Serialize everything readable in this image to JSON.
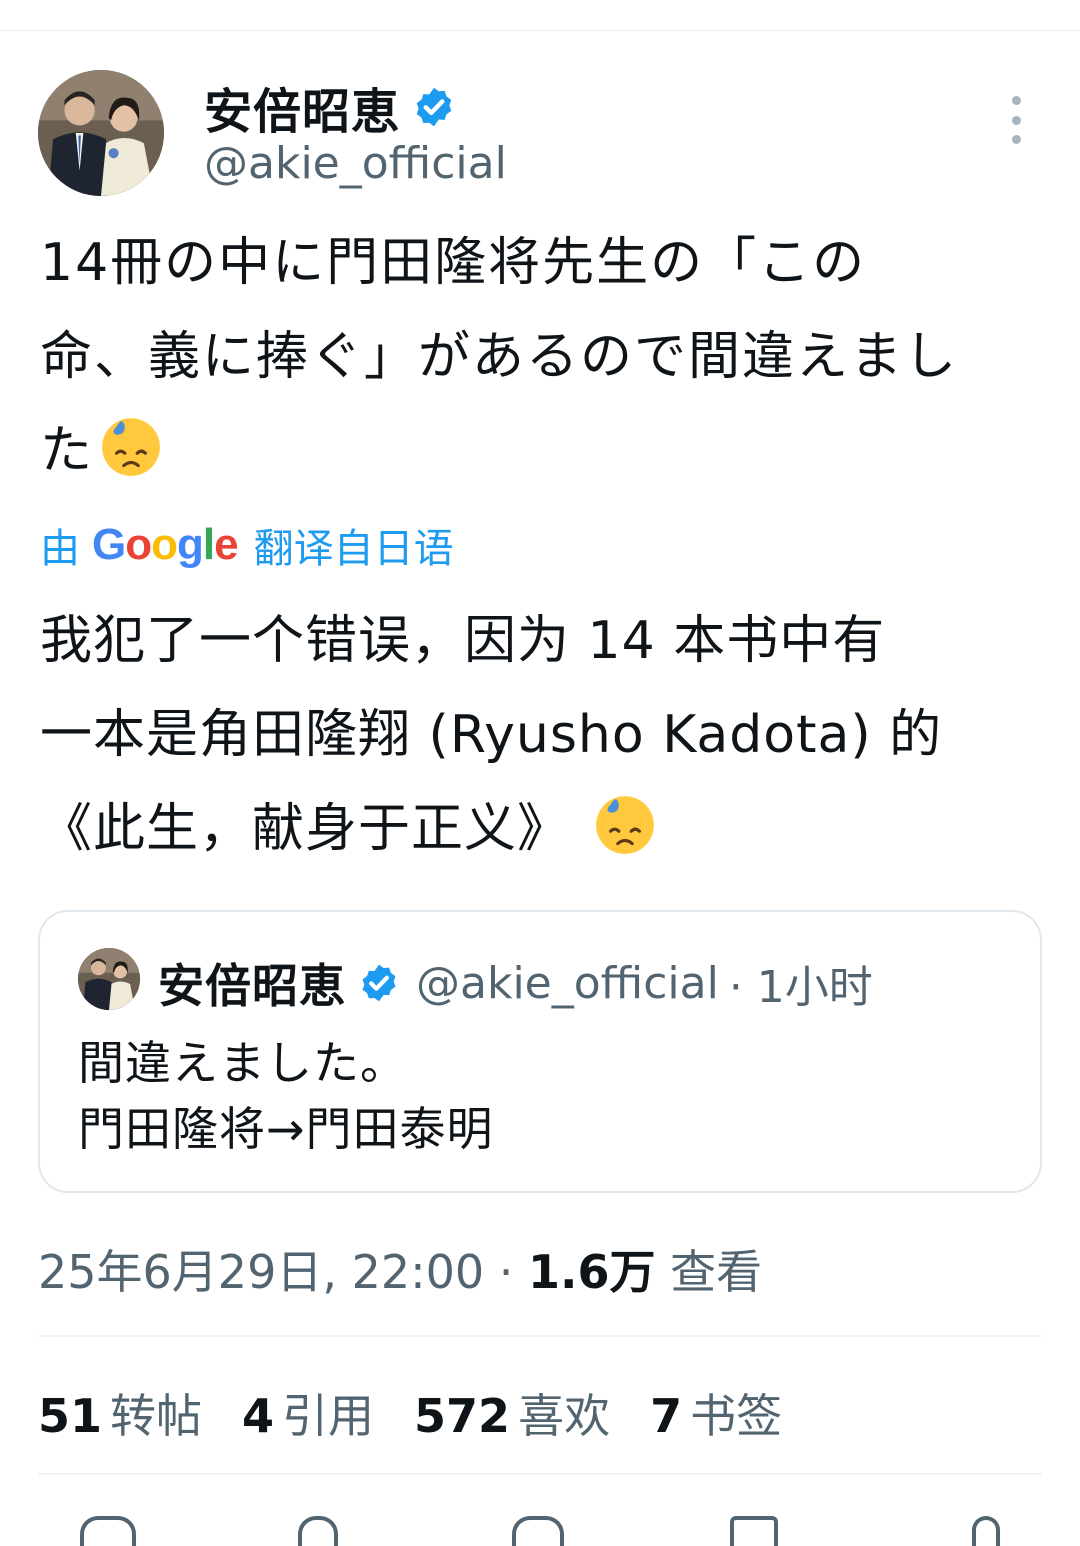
{
  "author": {
    "display_name": "安倍昭恵",
    "handle": "@akie_official"
  },
  "tweet": {
    "lines": [
      "14冊の中に門田隆将先生の「この",
      "命、義に捧ぐ」があるので間違えまし",
      "た"
    ]
  },
  "translate": {
    "prefix": "由",
    "google": [
      "G",
      "o",
      "o",
      "g",
      "l",
      "e"
    ],
    "suffix": "翻译自日语"
  },
  "translation": {
    "lines": [
      "我犯了一个错误，因为 14 本书中有",
      "一本是角田隆翔 (Ryusho Kadota) 的",
      "《此生，献身于正义》"
    ]
  },
  "quoted_tweet": {
    "display_name": "安倍昭恵",
    "handle": "@akie_official",
    "time": "· 1小时",
    "body": "間違えました。\n門田隆将→門田泰明"
  },
  "meta": {
    "datetime": "25年6月29日, 22:00 ·",
    "views_count": "1.6万",
    "views_label": "查看"
  },
  "stats": [
    {
      "count": "51",
      "label": "转帖"
    },
    {
      "count": "4",
      "label": "引用"
    },
    {
      "count": "572",
      "label": "喜欢"
    },
    {
      "count": "7",
      "label": "书签"
    }
  ],
  "colors": {
    "link_blue": "#1d9bf0",
    "google_blue": "#4285f4",
    "google_red": "#ea4335",
    "google_yellow": "#fbbc05",
    "google_green": "#34a853",
    "secondary_text": "#536471"
  },
  "icons": {
    "verified": "verified-badge-icon",
    "more": "more-options-icon",
    "emoji": "downcast-face-with-sweat-icon"
  }
}
